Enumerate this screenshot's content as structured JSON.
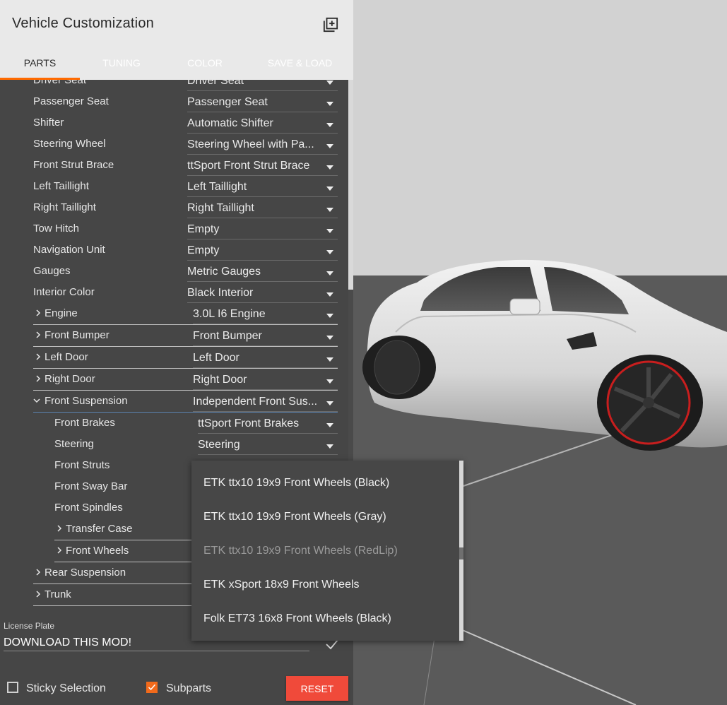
{
  "header": {
    "title": "Vehicle Customization",
    "add_icon": "add-box-icon"
  },
  "tabs": [
    {
      "label": "PARTS",
      "active": true
    },
    {
      "label": "TUNING",
      "active": false
    },
    {
      "label": "COLOR",
      "active": false
    },
    {
      "label": "SAVE & LOAD",
      "active": false
    }
  ],
  "parts": {
    "partial_top": {
      "label": "Driver Seat",
      "value": "Driver Seat"
    },
    "rows": [
      {
        "label": "Passenger Seat",
        "value": "Passenger Seat"
      },
      {
        "label": "Shifter",
        "value": "Automatic Shifter"
      },
      {
        "label": "Steering Wheel",
        "value": "Steering Wheel with Pa..."
      },
      {
        "label": "Front Strut Brace",
        "value": "ttSport Front Strut Brace"
      },
      {
        "label": "Left Taillight",
        "value": "Left Taillight"
      },
      {
        "label": "Right Taillight",
        "value": "Right Taillight"
      },
      {
        "label": "Tow Hitch",
        "value": "Empty"
      },
      {
        "label": "Navigation Unit",
        "value": "Empty"
      },
      {
        "label": "Gauges",
        "value": "Metric Gauges"
      },
      {
        "label": "Interior Color",
        "value": "Black Interior"
      },
      {
        "label": "Engine",
        "value": "3.0L I6 Engine"
      },
      {
        "label": "Front Bumper",
        "value": "Front Bumper"
      },
      {
        "label": "Left Door",
        "value": "Left Door"
      },
      {
        "label": "Right Door",
        "value": "Right Door"
      },
      {
        "label": "Front Suspension",
        "value": "Independent Front Sus..."
      },
      {
        "label": "Front Brakes",
        "value": "ttSport Front Brakes"
      },
      {
        "label": "Steering",
        "value": "Steering"
      },
      {
        "label": "Front Struts",
        "value": ""
      },
      {
        "label": "Front Sway Bar",
        "value": ""
      },
      {
        "label": "Front Spindles",
        "value": ""
      },
      {
        "label": "Transfer Case",
        "value": ""
      },
      {
        "label": "Front Wheels",
        "value": ""
      },
      {
        "label": "Rear Suspension",
        "value": ""
      },
      {
        "label": "Trunk",
        "value": ""
      }
    ]
  },
  "dropdown_options": [
    {
      "label": "ETK ttx10 19x9 Front Wheels (Black)",
      "disabled": false
    },
    {
      "label": "ETK ttx10 19x9 Front Wheels (Gray)",
      "disabled": false
    },
    {
      "label": "ETK ttx10 19x9 Front Wheels (RedLip)",
      "disabled": true
    },
    {
      "label": "ETK xSport 18x9 Front Wheels",
      "disabled": false
    },
    {
      "label": "Folk ET73 16x8 Front Wheels (Black)",
      "disabled": false
    }
  ],
  "license_plate": {
    "label": "License Plate",
    "value": "DOWNLOAD THIS MOD!"
  },
  "footer": {
    "sticky_label": "Sticky Selection",
    "sticky_checked": false,
    "subparts_label": "Subparts",
    "subparts_checked": true,
    "reset_label": "RESET"
  },
  "colors": {
    "accent": "#ff6a00",
    "reset": "#f04a3a",
    "panel": "#464646",
    "header": "#e9e9e9"
  }
}
